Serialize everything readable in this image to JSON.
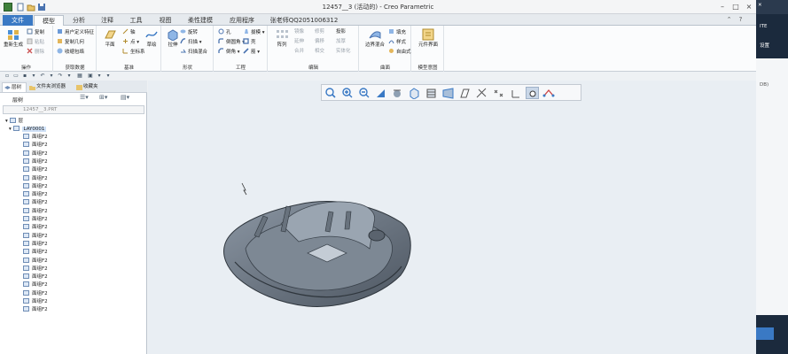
{
  "window": {
    "title": "12457__3 (活动的) - Creo Parametric"
  },
  "tabs": {
    "file": "文件",
    "model": "模型",
    "analysis": "分析",
    "annotate": "注释",
    "tools": "工具",
    "view": "视图",
    "flexible": "柔性建模",
    "apps": "应用程序",
    "custom": "张老师QQ2051006312"
  },
  "ribbon": {
    "regenerate": "重新生成",
    "copy": "复制",
    "paste": "粘贴",
    "delete": "删除",
    "udf": "用户定义特征",
    "copy_geom": "复制几何",
    "shrinkwrap": "收缩包络",
    "plane": "平面",
    "axis": "轴",
    "point": "点",
    "csys": "坐标系",
    "sketch": "草绘",
    "extrude": "拉伸",
    "revolve": "旋转",
    "sweep": "扫描",
    "swept_blend": "扫描混合",
    "hole": "孔",
    "round": "倒圆角",
    "chamfer": "倒角",
    "draft": "拔模",
    "shell": "壳",
    "rib": "筋",
    "pattern": "阵列",
    "mirror": "镜像",
    "extend": "延伸",
    "trim": "修剪",
    "offset": "偏移",
    "intersect": "相交",
    "merge": "合并",
    "solidify": "实体化",
    "project": "投影",
    "thicken": "加厚",
    "boundary_blend": "边界混合",
    "fill": "填充",
    "style": "样式",
    "freestyle": "自由式",
    "component_interface": "元件界面",
    "groups": {
      "operations": "操作",
      "get_data": "获取数据",
      "datum": "基准",
      "shapes": "形状",
      "engineering": "工程",
      "editing": "编辑",
      "surfaces": "曲面",
      "model_intent": "模型意图"
    }
  },
  "panel": {
    "tabs": [
      "层树",
      "文件夹浏览器",
      "收藏夹"
    ],
    "header": "层树",
    "filter_value": "12457__3.PRT",
    "root": "层",
    "selected": "LAY0001",
    "items": [
      "面组F2",
      "面组F2",
      "面组F2",
      "面组F2",
      "面组F2",
      "面组F2",
      "面组F2",
      "面组F2",
      "面组F2",
      "面组F2",
      "面组F2",
      "面组F2",
      "面组F2",
      "面组F2",
      "面组F2",
      "面组F2",
      "面组F2",
      "面组F2",
      "面组F2",
      "面组F2",
      "面组F2",
      "面组F2"
    ]
  },
  "side": {
    "text1": "ITE",
    "text2": "设置",
    "text3": "DB)"
  },
  "colors": {
    "accent": "#3a79c4",
    "model": "#6e7884"
  }
}
